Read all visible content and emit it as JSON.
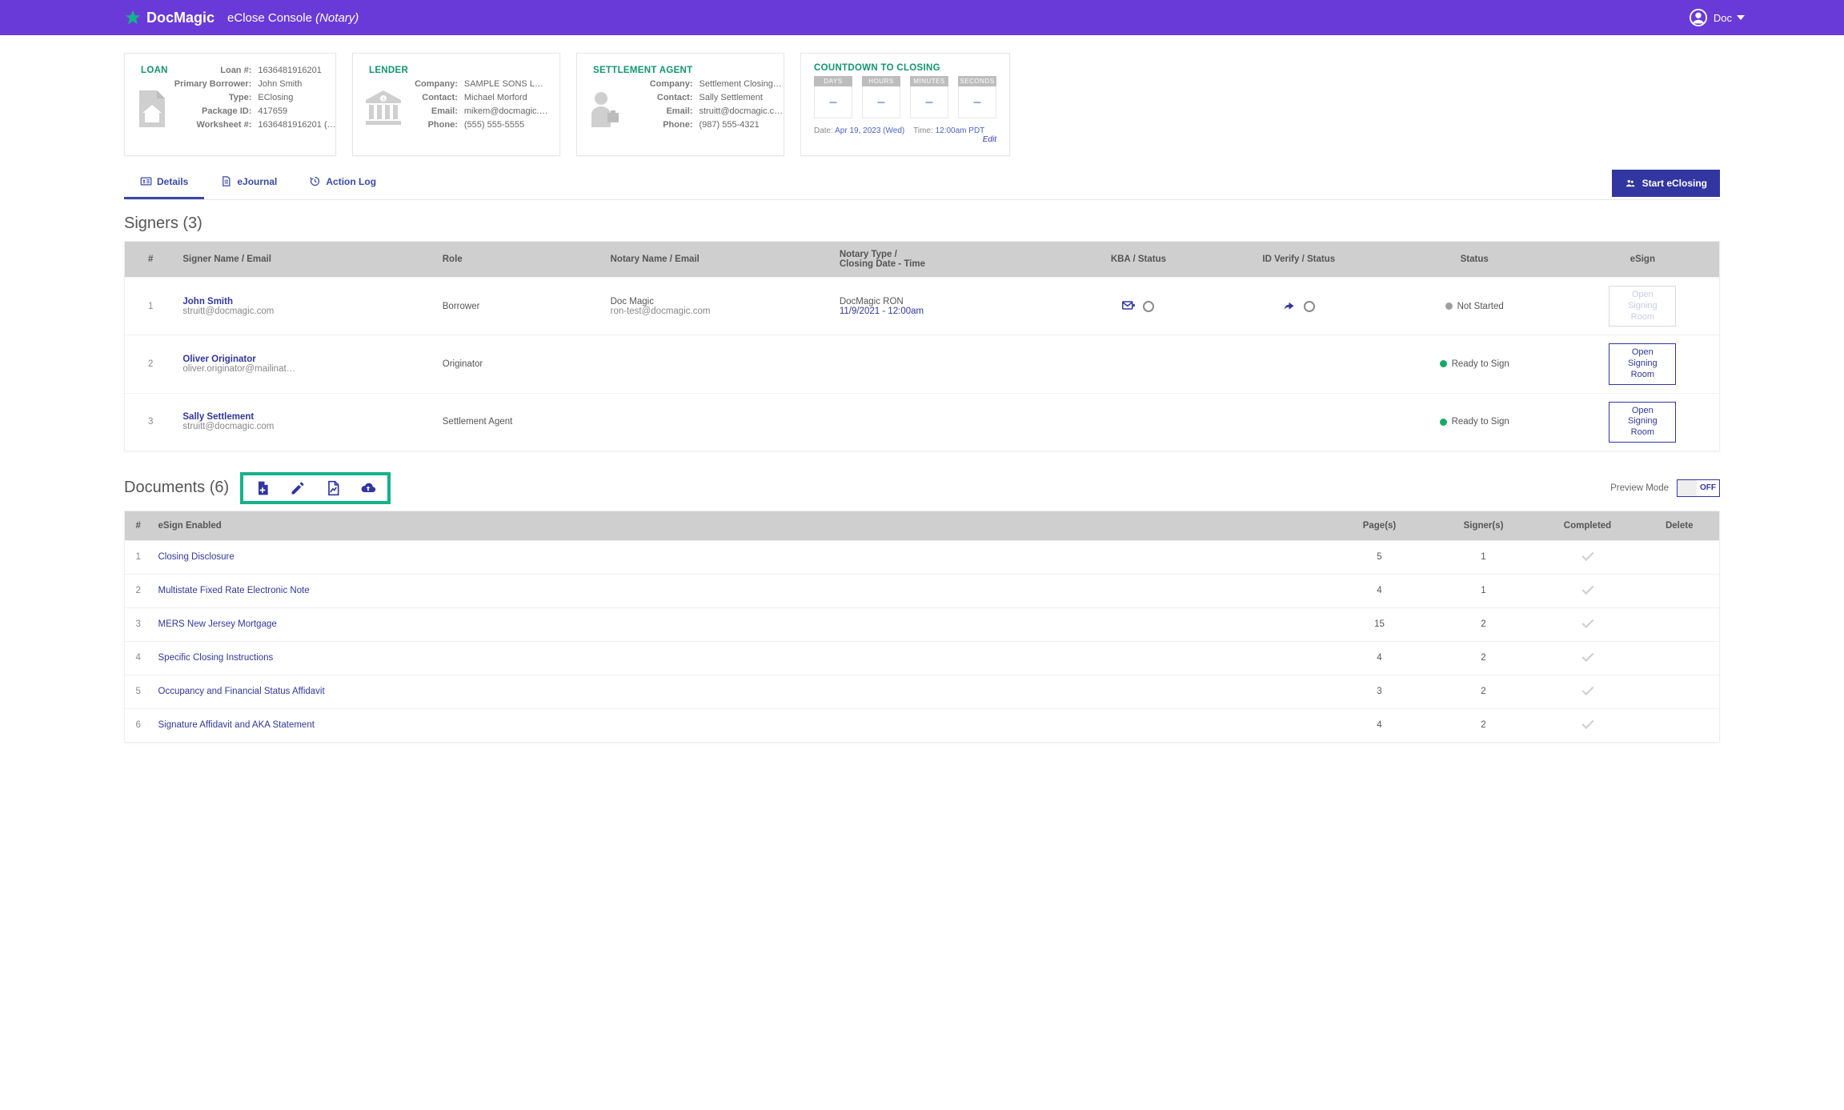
{
  "header": {
    "brand": "DocMagic",
    "console_title": "eClose Console",
    "console_role": "(Notary)",
    "user_name": "Doc"
  },
  "loan_card": {
    "title": "LOAN",
    "labels": {
      "loan_no": "Loan #:",
      "primary_borrower": "Primary Borrower:",
      "type": "Type:",
      "package_id": "Package ID:",
      "worksheet_no": "Worksheet #:"
    },
    "loan_no": "1636481916201",
    "primary_borrower": "John Smith",
    "type": "EClosing",
    "package_id": "417659",
    "worksheet_no": "1636481916201 (…"
  },
  "lender_card": {
    "title": "LENDER",
    "labels": {
      "company": "Company:",
      "contact": "Contact:",
      "email": "Email:",
      "phone": "Phone:"
    },
    "company": "SAMPLE SONS L…",
    "contact": "Michael Morford",
    "email": "mikem@docmagic.…",
    "phone": "(555) 555-5555"
  },
  "settlement_card": {
    "title": "SETTLEMENT AGENT",
    "labels": {
      "company": "Company:",
      "contact": "Contact:",
      "email": "Email:",
      "phone": "Phone:"
    },
    "company": "Settlement Closing…",
    "contact": "Sally Settlement",
    "email": "struitt@docmagic.c…",
    "phone": "(987) 555-4321"
  },
  "countdown_card": {
    "title": "COUNTDOWN TO CLOSING",
    "labels": {
      "days": "DAYS",
      "hours": "HOURS",
      "minutes": "MINUTES",
      "seconds": "SECONDS",
      "date": "Date:",
      "time": "Time:",
      "edit": "Edit"
    },
    "days": "–",
    "hours": "–",
    "minutes": "–",
    "seconds": "–",
    "date": "Apr 19, 2023 (Wed)",
    "time": "12:00am PDT"
  },
  "tabs": {
    "details": "Details",
    "ejournal": "eJournal",
    "action_log": "Action Log",
    "start_eclosing": "Start eClosing"
  },
  "signers_section": {
    "title": "Signers (3)",
    "headers": {
      "idx": "#",
      "name": "Signer Name / Email",
      "role": "Role",
      "notary": "Notary Name / Email",
      "notary_type": "Notary Type /\nClosing Date - Time",
      "kba": "KBA / Status",
      "idverify": "ID Verify / Status",
      "status": "Status",
      "esign": "eSign"
    },
    "rows": [
      {
        "idx": "1",
        "name": "John Smith",
        "email": "struitt@docmagic.com",
        "role": "Borrower",
        "notary_name": "Doc Magic",
        "notary_email": "ron-test@docmagic.com",
        "notary_type": "DocMagic RON",
        "closing_dt": "11/9/2021 - 12:00am",
        "status_text": "Not Started",
        "status_color": "gray",
        "esign_label": "Open\nSigning Room",
        "esign_enabled": false,
        "show_kba": true
      },
      {
        "idx": "2",
        "name": "Oliver Originator",
        "email": "oliver.originator@mailinat…",
        "role": "Originator",
        "notary_name": "",
        "notary_email": "",
        "notary_type": "",
        "closing_dt": "",
        "status_text": "Ready to Sign",
        "status_color": "green",
        "esign_label": "Open\nSigning Room",
        "esign_enabled": true,
        "show_kba": false
      },
      {
        "idx": "3",
        "name": "Sally Settlement",
        "email": "struitt@docmagic.com",
        "role": "Settlement Agent",
        "notary_name": "",
        "notary_email": "",
        "notary_type": "",
        "closing_dt": "",
        "status_text": "Ready to Sign",
        "status_color": "green",
        "esign_label": "Open\nSigning Room",
        "esign_enabled": true,
        "show_kba": false
      }
    ]
  },
  "documents_section": {
    "title": "Documents (6)",
    "preview_label": "Preview Mode",
    "preview_state": "OFF",
    "headers": {
      "idx": "#",
      "name": "eSign Enabled",
      "pages": "Page(s)",
      "signers": "Signer(s)",
      "completed": "Completed",
      "delete": "Delete"
    },
    "rows": [
      {
        "idx": "1",
        "name": "Closing Disclosure",
        "pages": "5",
        "signers": "1"
      },
      {
        "idx": "2",
        "name": "Multistate Fixed Rate Electronic Note",
        "pages": "4",
        "signers": "1"
      },
      {
        "idx": "3",
        "name": "MERS New Jersey Mortgage",
        "pages": "15",
        "signers": "2"
      },
      {
        "idx": "4",
        "name": "Specific Closing Instructions",
        "pages": "4",
        "signers": "2"
      },
      {
        "idx": "5",
        "name": "Occupancy and Financial Status Affidavit",
        "pages": "3",
        "signers": "2"
      },
      {
        "idx": "6",
        "name": "Signature Affidavit and AKA Statement",
        "pages": "4",
        "signers": "2"
      }
    ]
  }
}
